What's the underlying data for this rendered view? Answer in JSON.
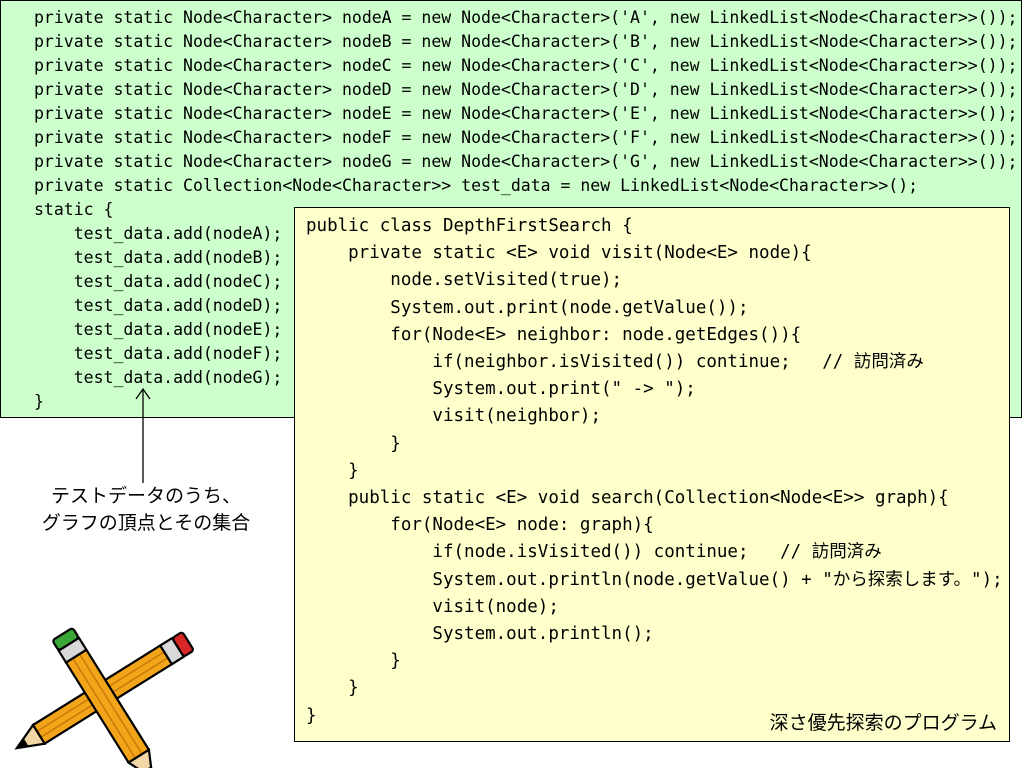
{
  "green_code": {
    "lines": [
      "private static Node<Character> nodeA = new Node<Character>('A', new LinkedList<Node<Character>>());",
      "private static Node<Character> nodeB = new Node<Character>('B', new LinkedList<Node<Character>>());",
      "private static Node<Character> nodeC = new Node<Character>('C', new LinkedList<Node<Character>>());",
      "private static Node<Character> nodeD = new Node<Character>('D', new LinkedList<Node<Character>>());",
      "private static Node<Character> nodeE = new Node<Character>('E', new LinkedList<Node<Character>>());",
      "private static Node<Character> nodeF = new Node<Character>('F', new LinkedList<Node<Character>>());",
      "private static Node<Character> nodeG = new Node<Character>('G', new LinkedList<Node<Character>>());",
      "private static Collection<Node<Character>> test_data = new LinkedList<Node<Character>>();",
      "static {",
      "    test_data.add(nodeA);",
      "    test_data.add(nodeB);",
      "    test_data.add(nodeC);",
      "    test_data.add(nodeD);",
      "    test_data.add(nodeE);",
      "    test_data.add(nodeF);",
      "    test_data.add(nodeG);",
      "}"
    ]
  },
  "yellow_code": {
    "lines": [
      "public class DepthFirstSearch {",
      "    private static <E> void visit(Node<E> node){",
      "        node.setVisited(true);",
      "        System.out.print(node.getValue());",
      "        for(Node<E> neighbor: node.getEdges()){",
      "            if(neighbor.isVisited()) continue;   // 訪問済み",
      "            System.out.print(\" -> \");",
      "            visit(neighbor);",
      "        }",
      "    }",
      "    public static <E> void search(Collection<Node<E>> graph){",
      "        for(Node<E> node: graph){",
      "            if(node.isVisited()) continue;   // 訪問済み",
      "            System.out.println(node.getValue() + \"から探索します。\");",
      "            visit(node);",
      "            System.out.println();",
      "        }",
      "    }",
      "}"
    ]
  },
  "caption": "深さ優先探索のプログラム",
  "side_note": {
    "line1": "テストデータのうち、",
    "line2": "グラフの頂点とその集合"
  },
  "colors": {
    "green_bg": "#ccffcc",
    "yellow_bg": "#ffffcc"
  },
  "icons": {
    "pencils": "crossed-pencils-clipart-icon",
    "arrow": "up-arrow-icon"
  }
}
